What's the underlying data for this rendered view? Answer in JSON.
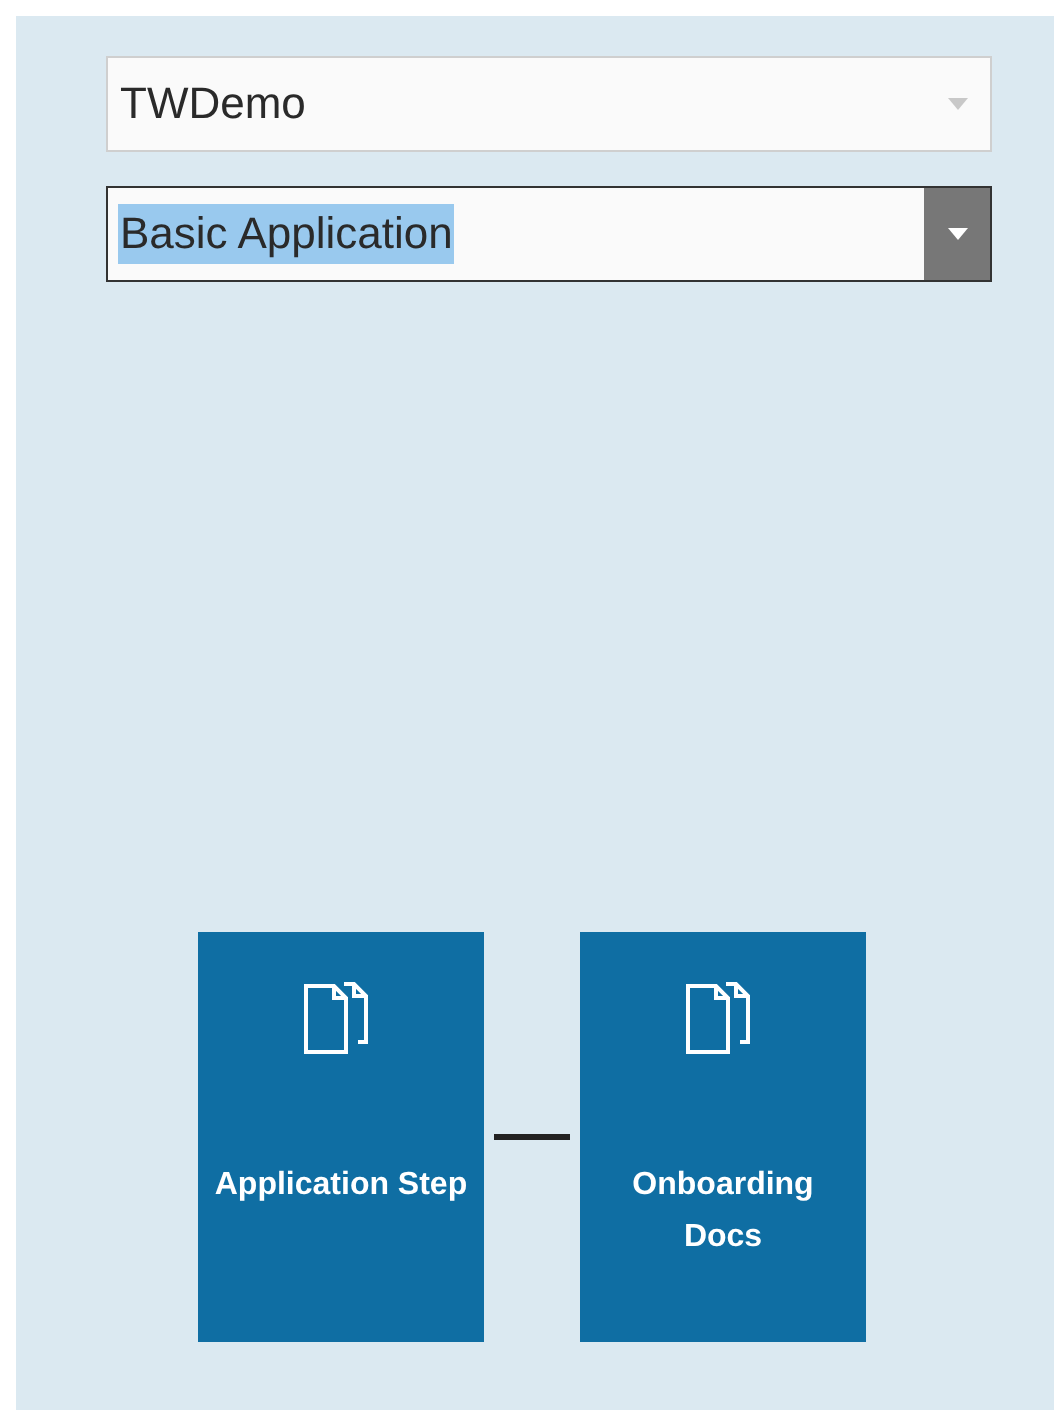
{
  "dropdowns": [
    {
      "value": "TWDemo",
      "focused": false
    },
    {
      "value": "Basic Application",
      "focused": true
    }
  ],
  "steps": [
    {
      "label": "Application Step"
    },
    {
      "label": "Onboarding Docs"
    }
  ]
}
